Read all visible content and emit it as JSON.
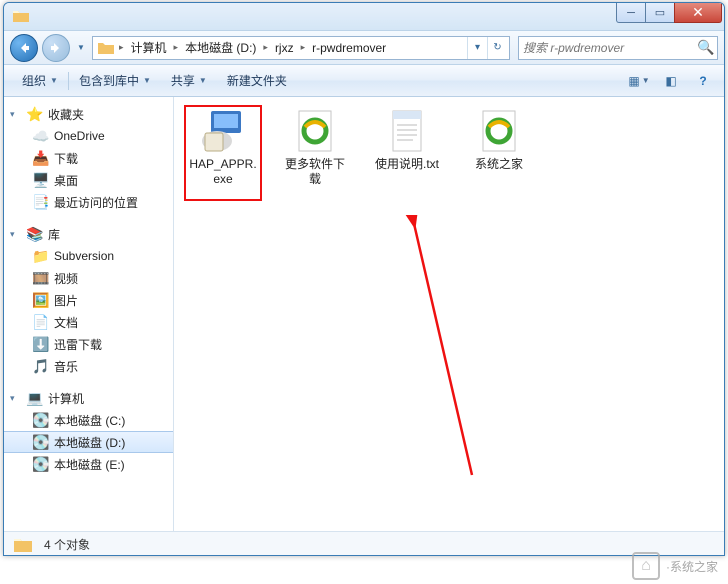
{
  "breadcrumb": {
    "items": [
      "计算机",
      "本地磁盘 (D:)",
      "rjxz",
      "r-pwdremover"
    ]
  },
  "search": {
    "placeholder": "搜索 r-pwdremover"
  },
  "toolbar": {
    "organize": "组织",
    "include": "包含到库中",
    "share": "共享",
    "newfolder": "新建文件夹"
  },
  "sidebar": {
    "favorites": {
      "label": "收藏夹",
      "items": [
        "OneDrive",
        "下载",
        "桌面",
        "最近访问的位置"
      ]
    },
    "library": {
      "label": "库",
      "items": [
        "Subversion",
        "视频",
        "图片",
        "文档",
        "迅雷下载",
        "音乐"
      ]
    },
    "computer": {
      "label": "计算机",
      "items": [
        "本地磁盘 (C:)",
        "本地磁盘 (D:)",
        "本地磁盘 (E:)"
      ],
      "selectedIndex": 1
    }
  },
  "files": [
    {
      "name": "HAP_APPR.exe",
      "type": "installer"
    },
    {
      "name": "更多软件下载",
      "type": "ie"
    },
    {
      "name": "使用说明.txt",
      "type": "txt"
    },
    {
      "name": "系统之家",
      "type": "ie"
    }
  ],
  "status": {
    "count_label": "4 个对象"
  },
  "watermark": {
    "text": "·系统之家"
  }
}
